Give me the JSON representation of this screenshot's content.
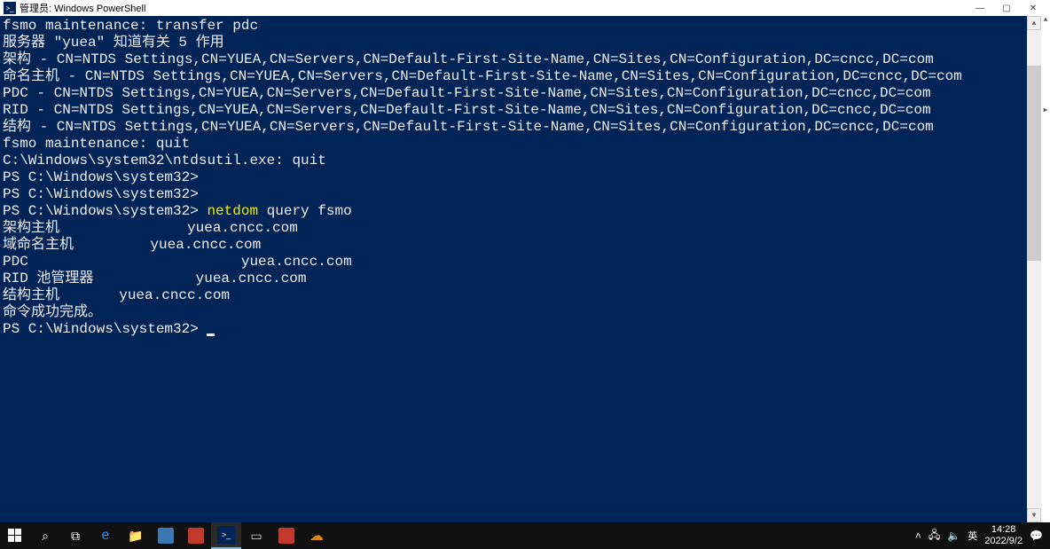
{
  "window": {
    "title": "管理员: Windows PowerShell"
  },
  "terminal": {
    "lines": [
      {
        "text": "fsmo maintenance: transfer pdc"
      },
      {
        "text": "服务器 \"yuea\" 知道有关 5 作用"
      },
      {
        "text": "架构 - CN=NTDS Settings,CN=YUEA,CN=Servers,CN=Default-First-Site-Name,CN=Sites,CN=Configuration,DC=cncc,DC=com"
      },
      {
        "text": "命名主机 - CN=NTDS Settings,CN=YUEA,CN=Servers,CN=Default-First-Site-Name,CN=Sites,CN=Configuration,DC=cncc,DC=com"
      },
      {
        "text": "PDC - CN=NTDS Settings,CN=YUEA,CN=Servers,CN=Default-First-Site-Name,CN=Sites,CN=Configuration,DC=cncc,DC=com"
      },
      {
        "text": "RID - CN=NTDS Settings,CN=YUEA,CN=Servers,CN=Default-First-Site-Name,CN=Sites,CN=Configuration,DC=cncc,DC=com"
      },
      {
        "text": "结构 - CN=NTDS Settings,CN=YUEA,CN=Servers,CN=Default-First-Site-Name,CN=Sites,CN=Configuration,DC=cncc,DC=com"
      },
      {
        "text": "fsmo maintenance: quit"
      },
      {
        "text": "C:\\Windows\\system32\\ntdsutil.exe: quit"
      },
      {
        "text": "PS C:\\Windows\\system32>"
      },
      {
        "text": "PS C:\\Windows\\system32>"
      },
      {
        "prompt": "PS C:\\Windows\\system32> ",
        "cmd": "netdom",
        "args": " query fsmo"
      },
      {
        "text": "架构主机               yuea.cncc.com"
      },
      {
        "text": "域命名主机         yuea.cncc.com"
      },
      {
        "text": "PDC                         yuea.cncc.com"
      },
      {
        "text": "RID 池管理器            yuea.cncc.com"
      },
      {
        "text": "结构主机       yuea.cncc.com"
      },
      {
        "text": "命令成功完成。"
      },
      {
        "text": ""
      },
      {
        "prompt": "PS C:\\Windows\\system32> ",
        "cursor": true
      }
    ]
  },
  "taskbar": {
    "ime": "英",
    "time": "14:28",
    "date": "2022/9/2"
  }
}
